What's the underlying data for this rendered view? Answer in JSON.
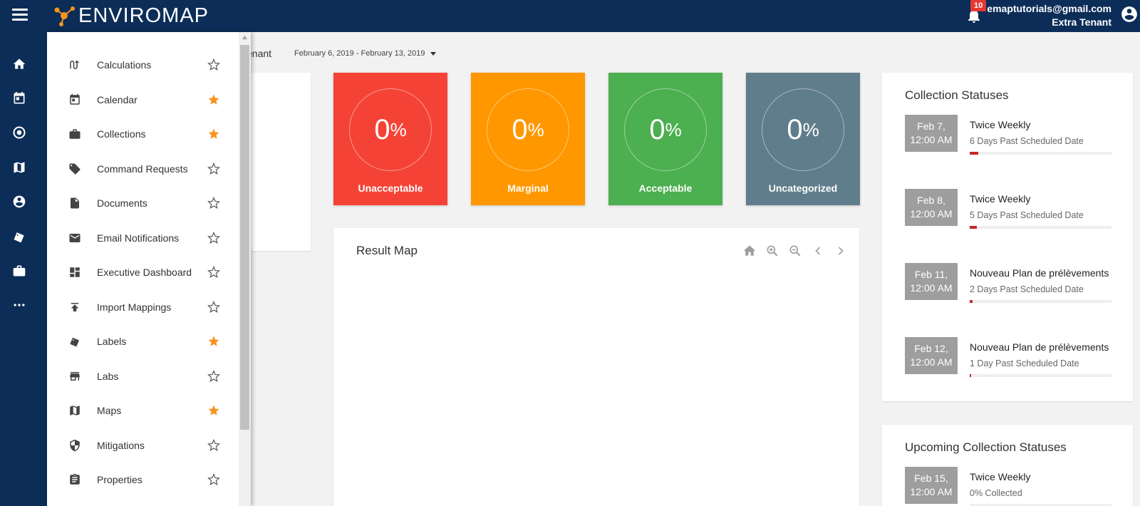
{
  "app": {
    "name": "ENVIROMAP"
  },
  "header": {
    "notifications_count": "10",
    "user_email": "emaptutorials@gmail.com",
    "tenant": "Extra Tenant"
  },
  "rail": {
    "items": [
      "home-icon",
      "calendar-icon",
      "target-icon",
      "map-icon",
      "account-icon",
      "labels-icon",
      "briefcase-icon",
      "more-icon"
    ]
  },
  "menu": {
    "items": [
      {
        "label": "Calculations",
        "icon": "calculations-icon",
        "starred": false
      },
      {
        "label": "Calendar",
        "icon": "calendar-icon",
        "starred": true
      },
      {
        "label": "Collections",
        "icon": "briefcase-icon",
        "starred": true
      },
      {
        "label": "Command Requests",
        "icon": "tag-icon",
        "starred": false
      },
      {
        "label": "Documents",
        "icon": "document-icon",
        "starred": false
      },
      {
        "label": "Email Notifications",
        "icon": "email-icon",
        "starred": false
      },
      {
        "label": "Executive Dashboard",
        "icon": "dashboard-icon",
        "starred": false
      },
      {
        "label": "Import Mappings",
        "icon": "upload-icon",
        "starred": false
      },
      {
        "label": "Labels",
        "icon": "labels-icon",
        "starred": true
      },
      {
        "label": "Labs",
        "icon": "store-icon",
        "starred": false
      },
      {
        "label": "Maps",
        "icon": "map-icon",
        "starred": true
      },
      {
        "label": "Mitigations",
        "icon": "shield-icon",
        "starred": false
      },
      {
        "label": "Properties",
        "icon": "clipboard-icon",
        "starred": false
      }
    ],
    "star_color": "#f7931e"
  },
  "filters": {
    "tenant_fragment": "enant",
    "date_range": "February 6, 2019 - February 13, 2019"
  },
  "stats": [
    {
      "value": "0",
      "unit": "%",
      "label": "Unacceptable",
      "color": "#f44336"
    },
    {
      "value": "0",
      "unit": "%",
      "label": "Marginal",
      "color": "#ff9800"
    },
    {
      "value": "0",
      "unit": "%",
      "label": "Acceptable",
      "color": "#4caf50"
    },
    {
      "value": "0",
      "unit": "%",
      "label": "Uncategorized",
      "color": "#607d8b"
    }
  ],
  "map": {
    "title": "Result Map",
    "controls": [
      "home-icon",
      "zoom-in-icon",
      "zoom-out-icon",
      "previous-icon",
      "next-icon"
    ]
  },
  "collection_statuses": {
    "title": "Collection Statuses",
    "entries": [
      {
        "date": "Feb 7,",
        "time": "12:00 AM",
        "title": "Twice Weekly",
        "subtitle": "6 Days Past Scheduled Date",
        "progress": 0.06
      },
      {
        "date": "Feb 8,",
        "time": "12:00 AM",
        "title": "Twice Weekly",
        "subtitle": "5 Days Past Scheduled Date",
        "progress": 0.05
      },
      {
        "date": "Feb 11,",
        "time": "12:00 AM",
        "title": "Nouveau Plan de prélèvements",
        "subtitle": "2 Days Past Scheduled Date",
        "progress": 0.02
      },
      {
        "date": "Feb 12,",
        "time": "12:00 AM",
        "title": "Nouveau Plan de prélèvements",
        "subtitle": "1 Day Past Scheduled Date",
        "progress": 0.01
      }
    ]
  },
  "upcoming_collection_statuses": {
    "title": "Upcoming Collection Statuses",
    "entries": [
      {
        "date": "Feb 15,",
        "time": "12:00 AM",
        "title": "Twice Weekly",
        "subtitle": "0% Collected",
        "progress": 0
      }
    ]
  }
}
